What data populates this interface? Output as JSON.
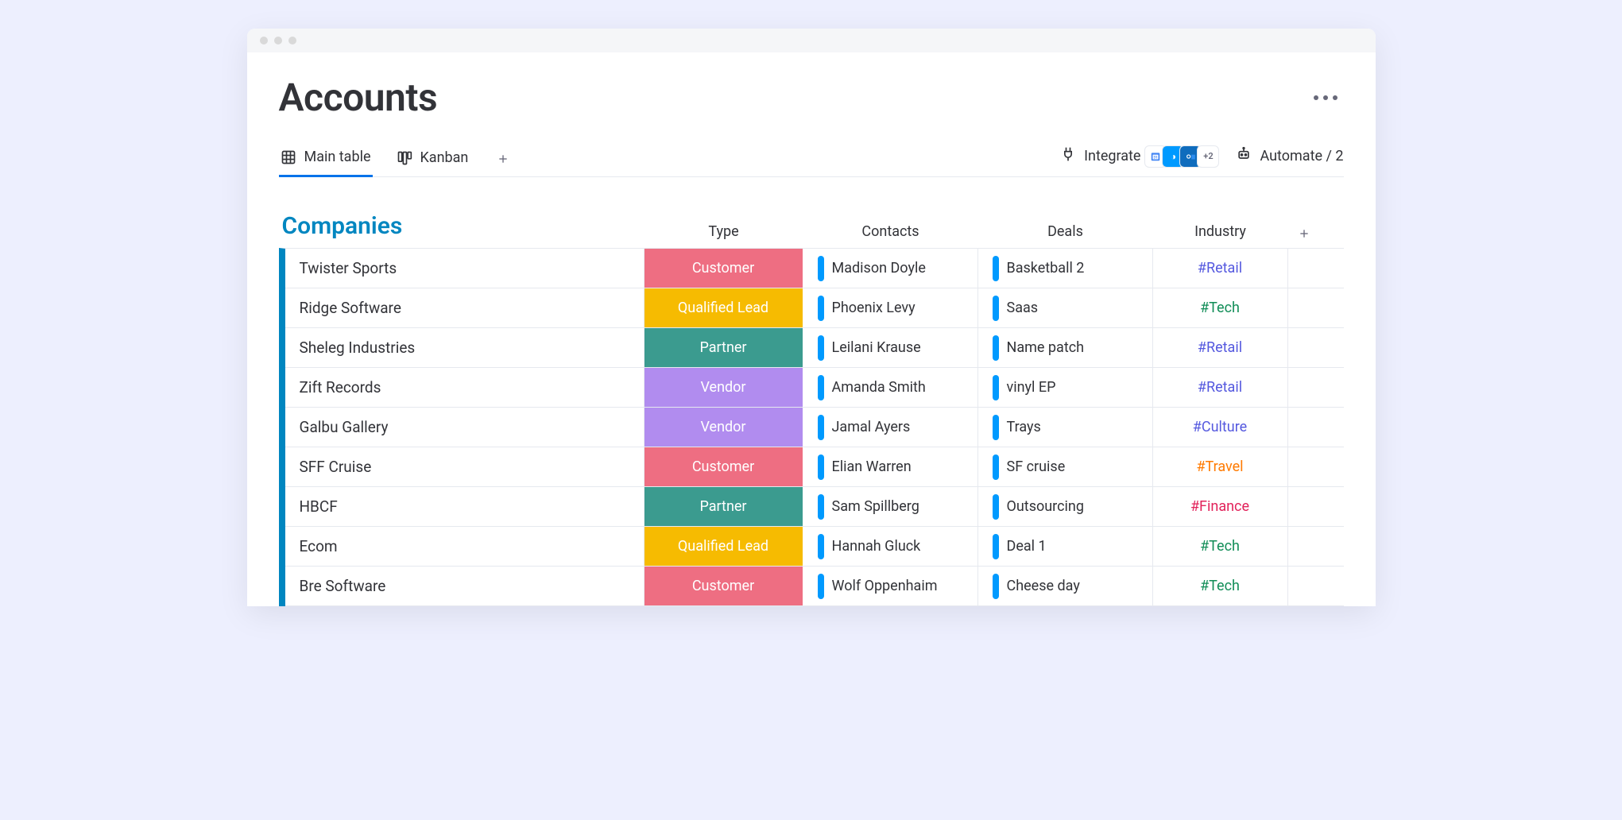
{
  "title": "Accounts",
  "tabs": {
    "main": "Main table",
    "kanban": "Kanban"
  },
  "actions": {
    "integrate": "Integrate",
    "automate": "Automate / 2",
    "integration_more": "+2"
  },
  "group": {
    "title": "Companies",
    "columns": {
      "type": "Type",
      "contacts": "Contacts",
      "deals": "Deals",
      "industry": "Industry"
    }
  },
  "type_colors": {
    "Customer": "#EE6E82",
    "Qualified Lead": "#F6BB01",
    "Partner": "#3B9B8F",
    "Vendor": "#B18CEF"
  },
  "industry_colors": {
    "#Retail": "#5559DF",
    "#Tech": "#118D57",
    "#Culture": "#5559DF",
    "#Travel": "#FF7A00",
    "#Finance": "#E2235B"
  },
  "rows": [
    {
      "name": "Twister Sports",
      "type": "Customer",
      "contact": "Madison Doyle",
      "deal": "Basketball 2",
      "industry": "#Retail"
    },
    {
      "name": "Ridge Software",
      "type": "Qualified Lead",
      "contact": "Phoenix Levy",
      "deal": "Saas",
      "industry": "#Tech"
    },
    {
      "name": "Sheleg Industries",
      "type": "Partner",
      "contact": "Leilani Krause",
      "deal": "Name patch",
      "industry": "#Retail"
    },
    {
      "name": "Zift Records",
      "type": "Vendor",
      "contact": "Amanda Smith",
      "deal": "vinyl EP",
      "industry": "#Retail"
    },
    {
      "name": "Galbu Gallery",
      "type": "Vendor",
      "contact": "Jamal Ayers",
      "deal": "Trays",
      "industry": "#Culture"
    },
    {
      "name": "SFF Cruise",
      "type": "Customer",
      "contact": "Elian Warren",
      "deal": "SF cruise",
      "industry": "#Travel"
    },
    {
      "name": "HBCF",
      "type": "Partner",
      "contact": "Sam Spillberg",
      "deal": "Outsourcing",
      "industry": "#Finance"
    },
    {
      "name": "Ecom",
      "type": "Qualified Lead",
      "contact": "Hannah Gluck",
      "deal": "Deal 1",
      "industry": "#Tech"
    },
    {
      "name": "Bre Software",
      "type": "Customer",
      "contact": "Wolf Oppenhaim",
      "deal": "Cheese day",
      "industry": "#Tech"
    }
  ]
}
